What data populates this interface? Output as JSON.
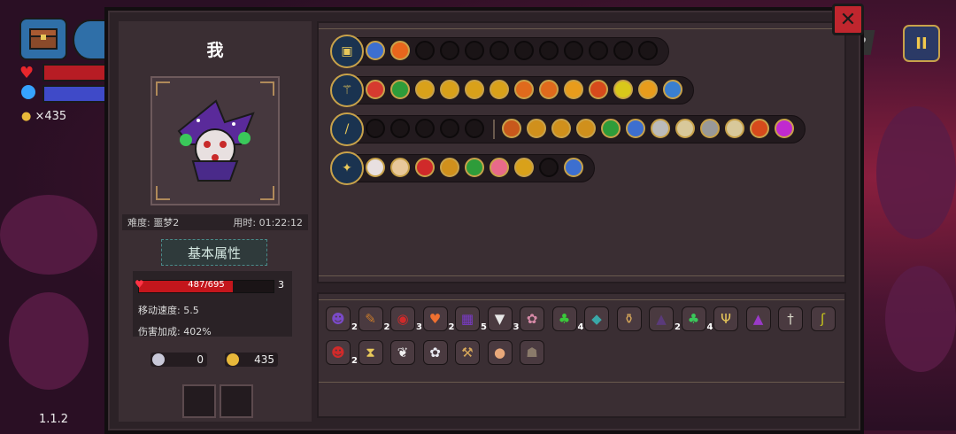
{
  "hud": {
    "coins": "×435",
    "version": "1.1.2",
    "pause_label": "II",
    "help_label": "?",
    "icons": [
      "chest-icon",
      "weapon-icon",
      "heart-icon",
      "mana-orb-icon",
      "coin-icon"
    ]
  },
  "panel": {
    "close_label": "✕",
    "player_name": "我",
    "difficulty": "难度: 噩梦2",
    "time": "用时: 01:22:12",
    "attr_title": "基本属性",
    "hp_text": "487/695",
    "hp_fraction": 0.7,
    "hp_extra": "3",
    "move_speed": "移动速度: 5.5",
    "damage_bonus": "伤害加成: 402%",
    "keys": "0",
    "gold": "435"
  },
  "weapon_rows": [
    {
      "weapon_icon": "chest-icon",
      "gems": [
        {
          "icon": "blue-slime",
          "color": "#3d6fd0"
        },
        {
          "icon": "fire-swirl",
          "color": "#e8661c"
        }
      ],
      "empty": 10
    },
    {
      "weapon_icon": "staff-icon",
      "gems": [
        {
          "icon": "target",
          "color": "#d63a2f"
        },
        {
          "icon": "skull",
          "color": "#2e9c3a"
        },
        {
          "icon": "up-arrows",
          "color": "#d9a11a"
        },
        {
          "icon": "up-arrows",
          "color": "#d9a11a"
        },
        {
          "icon": "up-arrows",
          "color": "#d9a11a"
        },
        {
          "icon": "up-arrows",
          "color": "#d9a11a"
        },
        {
          "icon": "claw",
          "color": "#e06a1c"
        },
        {
          "icon": "claw",
          "color": "#e06a1c"
        },
        {
          "icon": "chevrons",
          "color": "#e89c1c"
        },
        {
          "icon": "radiation",
          "color": "#d64a1c"
        },
        {
          "icon": "ghost",
          "color": "#d9c81a"
        },
        {
          "icon": "chevrons",
          "color": "#e89c1c"
        },
        {
          "icon": "crest",
          "color": "#3a7fd0"
        }
      ],
      "empty": 0
    },
    {
      "weapon_icon": "sword-icon",
      "gems": [],
      "empty": 5,
      "extra": [
        {
          "icon": "fist",
          "color": "#c8581c"
        },
        {
          "icon": "spark",
          "color": "#d0901c"
        },
        {
          "icon": "spark",
          "color": "#d0901c"
        },
        {
          "icon": "spark",
          "color": "#d0901c"
        },
        {
          "icon": "skull",
          "color": "#2e9c3a"
        },
        {
          "icon": "blue-slime",
          "color": "#3d6fd0"
        },
        {
          "icon": "eye",
          "color": "#bbbbbb"
        },
        {
          "icon": "book",
          "color": "#d8c89a"
        },
        {
          "icon": "orb",
          "color": "#999999"
        },
        {
          "icon": "book",
          "color": "#d8c89a"
        },
        {
          "icon": "radiation",
          "color": "#d64a1c"
        },
        {
          "icon": "flame",
          "color": "#c02ad0"
        }
      ]
    },
    {
      "weapon_icon": "wand-icon",
      "gems": [
        {
          "icon": "skull",
          "color": "#e8e0e0"
        },
        {
          "icon": "cloud",
          "color": "#e8c89a"
        },
        {
          "icon": "cherry",
          "color": "#d02a2a"
        },
        {
          "icon": "spark",
          "color": "#d0901c"
        },
        {
          "icon": "skull",
          "color": "#2e9c3a"
        },
        {
          "icon": "pig",
          "color": "#e86a8a"
        },
        {
          "icon": "up-arrows",
          "color": "#d9a11a"
        }
      ],
      "empty": 1,
      "tail": {
        "icon": "blue-slime",
        "color": "#3d6fd0"
      }
    }
  ],
  "items_row1": [
    {
      "name": "witch-hat-portrait",
      "glyph": "☻",
      "color": "#7a4ac8",
      "count": "2"
    },
    {
      "name": "scroll",
      "glyph": "✎",
      "color": "#c87a2a",
      "count": "2"
    },
    {
      "name": "red-eye",
      "glyph": "◉",
      "color": "#d02a2a",
      "count": "3"
    },
    {
      "name": "heart",
      "glyph": "♥",
      "color": "#f07030",
      "count": "2"
    },
    {
      "name": "spellbook",
      "glyph": "▦",
      "color": "#7a3ac8",
      "count": "5"
    },
    {
      "name": "fangs",
      "glyph": "▼",
      "color": "#e8e8e8",
      "count": "3"
    },
    {
      "name": "brain",
      "glyph": "✿",
      "color": "#d88aa8",
      "count": ""
    },
    {
      "name": "green-flame",
      "glyph": "♣",
      "color": "#3ac83a",
      "count": "4"
    },
    {
      "name": "teal-tile",
      "glyph": "◆",
      "color": "#3aa8a8",
      "count": ""
    },
    {
      "name": "urn",
      "glyph": "⚱",
      "color": "#d8a85a",
      "count": ""
    },
    {
      "name": "shadow-cloak",
      "glyph": "▲",
      "color": "#5a3a7a",
      "count": "2"
    },
    {
      "name": "clover",
      "glyph": "♣",
      "color": "#3ac85a",
      "count": "4"
    },
    {
      "name": "antlers",
      "glyph": "Ψ",
      "color": "#e8c85a",
      "count": ""
    },
    {
      "name": "purple-hat",
      "glyph": "▲",
      "color": "#9a3ac8",
      "count": ""
    },
    {
      "name": "dagger",
      "glyph": "†",
      "color": "#d8d8c8",
      "count": ""
    },
    {
      "name": "hook",
      "glyph": "ʃ",
      "color": "#c8c81a",
      "count": ""
    }
  ],
  "items_row2": [
    {
      "name": "demon-mask",
      "glyph": "☻",
      "color": "#d02a2a",
      "count": "2"
    },
    {
      "name": "hourglass",
      "glyph": "⧗",
      "color": "#e8c85a",
      "count": ""
    },
    {
      "name": "angel-wings",
      "glyph": "❦",
      "color": "#f0f0f0",
      "count": ""
    },
    {
      "name": "white-flower",
      "glyph": "✿",
      "color": "#e8e8f0",
      "count": ""
    },
    {
      "name": "pickaxe",
      "glyph": "⚒",
      "color": "#d8a85a",
      "count": ""
    },
    {
      "name": "egg",
      "glyph": "●",
      "color": "#e8a87a",
      "count": ""
    },
    {
      "name": "bat",
      "glyph": "☗",
      "color": "#8a7a6a",
      "count": ""
    }
  ]
}
